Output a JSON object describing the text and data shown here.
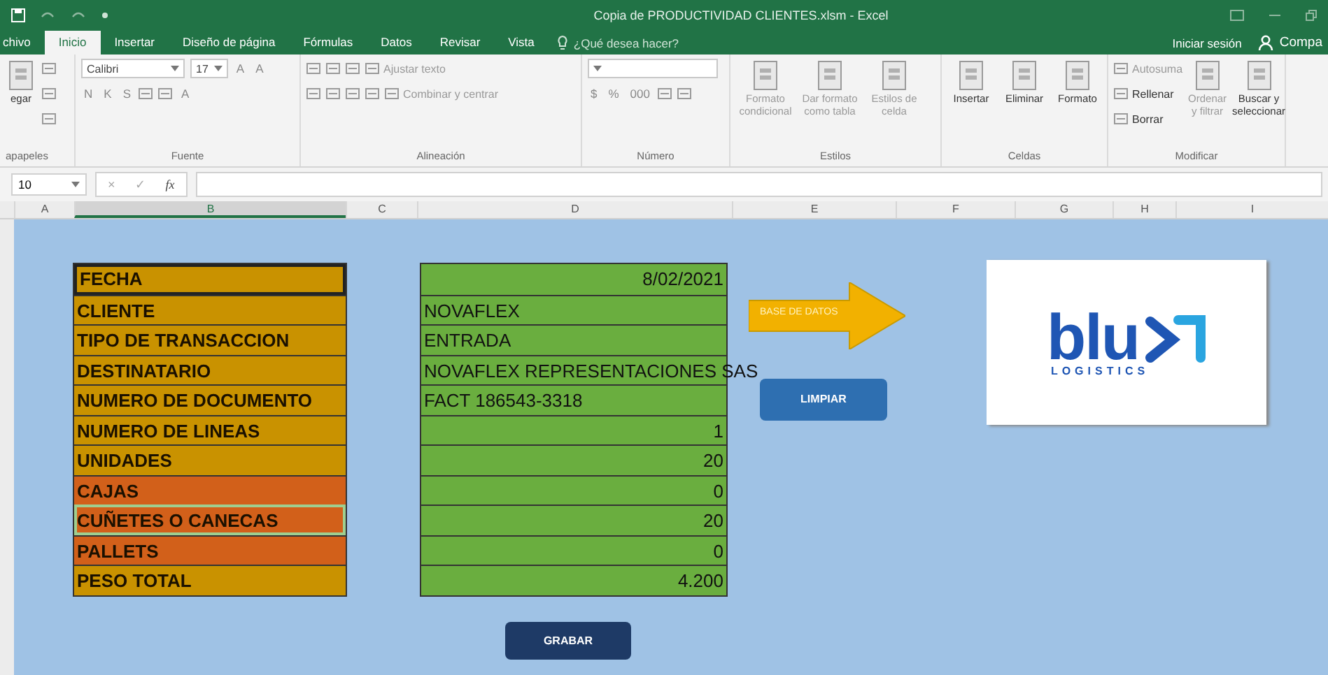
{
  "window": {
    "title": "Copia de PRODUCTIVIDAD CLIENTES.xlsm - Excel"
  },
  "tabs": [
    {
      "label": "chivo",
      "selected": false
    },
    {
      "label": "Inicio",
      "selected": true
    },
    {
      "label": "Insertar",
      "selected": false
    },
    {
      "label": "Diseño de página",
      "selected": false
    },
    {
      "label": "Fórmulas",
      "selected": false
    },
    {
      "label": "Datos",
      "selected": false
    },
    {
      "label": "Revisar",
      "selected": false
    },
    {
      "label": "Vista",
      "selected": false
    }
  ],
  "tell_me": {
    "placeholder": "¿Qué desea hacer?"
  },
  "account": {
    "sign_in": "Iniciar sesión",
    "share": "Compa"
  },
  "ribbon": {
    "groups": [
      {
        "label": "apapeles",
        "parts": [
          {
            "kind": "big",
            "label": "egar",
            "disabled": false
          },
          {
            "kind": "stack",
            "lines": [
              {
                "tools": [
                  {
                    "kind": "icon"
                  }
                ]
              },
              {
                "tools": [
                  {
                    "kind": "icon"
                  }
                ]
              },
              {
                "tools": [
                  {
                    "kind": "icon"
                  }
                ]
              }
            ]
          }
        ]
      },
      {
        "label": "Fuente",
        "parts": [
          {
            "kind": "stack",
            "lines": [
              {
                "tools": [
                  {
                    "kind": "field",
                    "value": "Calibri"
                  },
                  {
                    "kind": "field",
                    "value": "17"
                  },
                  {
                    "kind": "text",
                    "label": "A"
                  },
                  {
                    "kind": "text",
                    "label": "A"
                  }
                ]
              },
              {
                "tools": [
                  {
                    "kind": "text",
                    "label": "N"
                  },
                  {
                    "kind": "text",
                    "label": "K"
                  },
                  {
                    "kind": "text",
                    "label": "S"
                  },
                  {
                    "kind": "icon"
                  },
                  {
                    "kind": "icon"
                  },
                  {
                    "kind": "text",
                    "label": "A"
                  }
                ]
              }
            ]
          }
        ]
      },
      {
        "label": "Alineación",
        "parts": [
          {
            "kind": "stack",
            "lines": [
              {
                "tools": [
                  {
                    "kind": "icon"
                  },
                  {
                    "kind": "icon"
                  },
                  {
                    "kind": "icon"
                  },
                  {
                    "kind": "icontext",
                    "label": "Ajustar texto",
                    "disabled": true
                  }
                ]
              },
              {
                "tools": [
                  {
                    "kind": "icon"
                  },
                  {
                    "kind": "icon"
                  },
                  {
                    "kind": "icon"
                  },
                  {
                    "kind": "icon"
                  },
                  {
                    "kind": "icontext",
                    "label": "Combinar y centrar",
                    "disabled": true
                  }
                ]
              }
            ]
          }
        ]
      },
      {
        "label": "Número",
        "parts": [
          {
            "kind": "stack",
            "lines": [
              {
                "tools": [
                  {
                    "kind": "field"
                  }
                ]
              },
              {
                "tools": [
                  {
                    "kind": "text",
                    "label": "$"
                  },
                  {
                    "kind": "text",
                    "label": "%"
                  },
                  {
                    "kind": "text",
                    "label": "000"
                  },
                  {
                    "kind": "icon"
                  },
                  {
                    "kind": "icon"
                  }
                ]
              }
            ]
          }
        ]
      },
      {
        "label": "Estilos",
        "parts": [
          {
            "kind": "big",
            "label": "Formato condicional",
            "disabled": true
          },
          {
            "kind": "big",
            "label": "Dar formato como tabla",
            "disabled": true
          },
          {
            "kind": "big",
            "label": "Estilos de celda",
            "disabled": true
          }
        ]
      },
      {
        "label": "Celdas",
        "parts": [
          {
            "kind": "big",
            "label": "Insertar",
            "disabled": false
          },
          {
            "kind": "big",
            "label": "Eliminar",
            "disabled": false
          },
          {
            "kind": "big",
            "label": "Formato",
            "disabled": false
          }
        ]
      },
      {
        "label": "Modificar",
        "parts": [
          {
            "kind": "stack",
            "lines": [
              {
                "tools": [
                  {
                    "kind": "icontext",
                    "label": "Autosuma",
                    "disabled": true
                  }
                ]
              },
              {
                "tools": [
                  {
                    "kind": "icontext",
                    "label": "Rellenar",
                    "disabled": false
                  }
                ]
              },
              {
                "tools": [
                  {
                    "kind": "icontext",
                    "label": "Borrar",
                    "disabled": false
                  }
                ]
              }
            ]
          },
          {
            "kind": "big",
            "label": "Ordenar y filtrar",
            "disabled": true
          },
          {
            "kind": "big",
            "label": "Buscar y seleccionar",
            "disabled": false
          }
        ]
      }
    ]
  },
  "formula_bar": {
    "name_box": "10",
    "cancel": "×",
    "enter": "✓",
    "function_label": "fx"
  },
  "columns": [
    {
      "label": "A",
      "selected": false
    },
    {
      "label": "B",
      "selected": true
    },
    {
      "label": "C",
      "selected": false
    },
    {
      "label": "D",
      "selected": false
    },
    {
      "label": "E",
      "selected": false
    },
    {
      "label": "F",
      "selected": false
    },
    {
      "label": "G",
      "selected": false
    },
    {
      "label": "H",
      "selected": false
    },
    {
      "label": "I",
      "selected": false
    }
  ],
  "form": {
    "labels": [
      {
        "text": "FECHA",
        "color": "#c99200",
        "selected": false
      },
      {
        "text": "CLIENTE",
        "color": "#c99200",
        "selected": false
      },
      {
        "text": "TIPO DE TRANSACCION",
        "color": "#c99200",
        "selected": false
      },
      {
        "text": "DESTINATARIO",
        "color": "#c99200",
        "selected": false
      },
      {
        "text": "NUMERO DE DOCUMENTO",
        "color": "#c99200",
        "selected": false
      },
      {
        "text": "NUMERO DE LINEAS",
        "color": "#c99200",
        "selected": false
      },
      {
        "text": "UNIDADES",
        "color": "#c99200",
        "selected": false
      },
      {
        "text": "CAJAS",
        "color": "#d2601a",
        "selected": false
      },
      {
        "text": "CUÑETES O CANECAS",
        "color": "#d2601a",
        "selected": true
      },
      {
        "text": "PALLETS",
        "color": "#d2601a",
        "selected": false
      },
      {
        "text": "PESO TOTAL",
        "color": "#c99200",
        "selected": false
      }
    ],
    "values": [
      {
        "text": "8/02/2021",
        "kind": "number"
      },
      {
        "text": "NOVAFLEX",
        "kind": "text"
      },
      {
        "text": "ENTRADA",
        "kind": "text"
      },
      {
        "text": "NOVAFLEX REPRESENTACIONES SAS",
        "kind": "text"
      },
      {
        "text": "FACT 186543-3318",
        "kind": "text"
      },
      {
        "text": "1",
        "kind": "number"
      },
      {
        "text": "20",
        "kind": "number"
      },
      {
        "text": "0",
        "kind": "number"
      },
      {
        "text": "20",
        "kind": "number"
      },
      {
        "text": "0",
        "kind": "number"
      },
      {
        "text": "4.200",
        "kind": "number"
      }
    ]
  },
  "shapes": {
    "arrow": "BASE DE DATOS",
    "clear_button": "LIMPIAR",
    "save_button": "GRABAR"
  },
  "logo": {
    "wordmark": "blu",
    "tagline": "LOGISTICS"
  }
}
